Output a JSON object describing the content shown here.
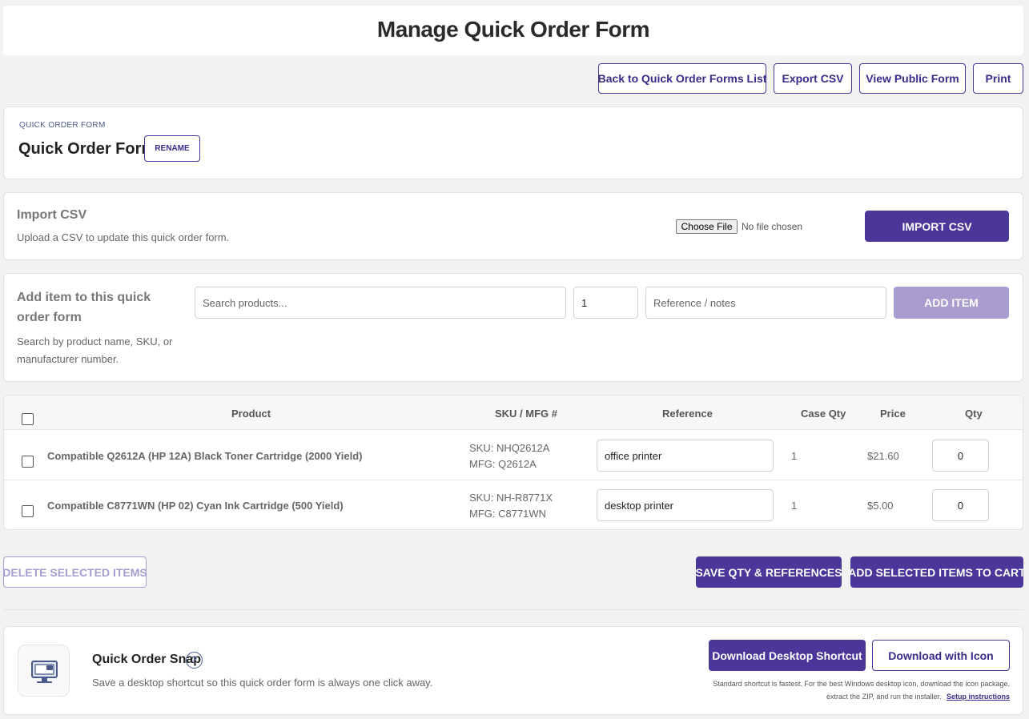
{
  "header": {
    "title": "Manage Quick Order Form"
  },
  "toolbar": {
    "back_label": "Back to Quick Order Forms List",
    "export_label": "Export CSV",
    "view_public_label": "View Public Form",
    "print_label": "Print"
  },
  "form_info": {
    "eyebrow": "QUICK ORDER FORM",
    "name": "Quick Order Form",
    "rename_label": "RENAME"
  },
  "import": {
    "title": "Import CSV",
    "description": "Upload a CSV to update this quick order form.",
    "choose_file_label": "Choose File",
    "no_file_text": "No file chosen",
    "button_label": "IMPORT CSV"
  },
  "add_item": {
    "title": "Add item to this quick order form",
    "description": "Search by product name, SKU, or manufacturer number.",
    "search_placeholder": "Search products...",
    "qty_value": "1",
    "reference_placeholder": "Reference / notes",
    "button_label": "ADD ITEM"
  },
  "table": {
    "headers": {
      "product": "Product",
      "sku": "SKU / MFG #",
      "reference": "Reference",
      "case_qty": "Case Qty",
      "price": "Price",
      "qty": "Qty"
    },
    "rows": [
      {
        "product": "Compatible Q2612A (HP 12A) Black Toner Cartridge (2000 Yield)",
        "sku": "SKU: NHQ2612A",
        "mfg": "MFG: Q2612A",
        "reference": "office printer",
        "case_qty": "1",
        "price": "$21.60",
        "qty": "0"
      },
      {
        "product": "Compatible C8771WN (HP 02) Cyan Ink Cartridge (500 Yield)",
        "sku": "SKU: NH-R8771X",
        "mfg": "MFG: C8771WN",
        "reference": "desktop printer",
        "case_qty": "1",
        "price": "$5.00",
        "qty": "0"
      }
    ]
  },
  "actions": {
    "delete_label": "DELETE SELECTED ITEMS",
    "save_label": "SAVE QTY & REFERENCES",
    "add_to_cart_label": "ADD SELECTED ITEMS TO CART"
  },
  "snap": {
    "title": "Quick Order Snap",
    "help_glyph": "?",
    "description": "Save a desktop shortcut so this quick order form is always one click away.",
    "download_shortcut_label": "Download Desktop Shortcut",
    "download_icon_label": "Download with Icon",
    "note": "Standard shortcut is fastest. For the best Windows desktop icon, download the icon package, extract the ZIP, and run the installer.",
    "setup_link": "Setup instructions"
  },
  "colors": {
    "brand": "#4b3699",
    "brand_disabled": "#a99ccf",
    "background": "#f2f2f2"
  }
}
